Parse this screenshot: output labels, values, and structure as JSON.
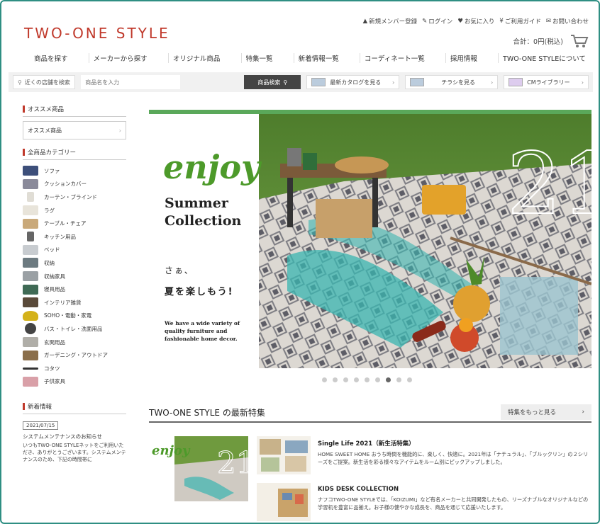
{
  "brand": {
    "logo_text": "TWO-ONE STYLE",
    "accent": "#c0392b",
    "frame_color": "#2f8f83"
  },
  "header": {
    "links": [
      "新規メンバー登録",
      "ログイン",
      "お気に入り",
      "ご利用ガイド",
      "お問い合わせ"
    ],
    "cart_total": "合計：0円(税込)"
  },
  "nav": {
    "items": [
      "商品を探す",
      "メーカーから探す",
      "オリジナル商品",
      "特集一覧",
      "新着情報一覧",
      "コーディネート一覧",
      "採用情報",
      "TWO-ONE STYLEについて"
    ]
  },
  "searchbar": {
    "store_search": "近くの店舗を検索",
    "product_placeholder": "商品名を入力",
    "search_button": "商品検索",
    "promos": [
      "最新カタログを見る",
      "チラシを見る",
      "CMライブラリー"
    ]
  },
  "sidebar": {
    "recommend_heading": "オススメ商品",
    "recommend_select": "オススメ商品",
    "category_heading": "全商品カテゴリー",
    "categories": [
      "ソファ",
      "クッションカバー",
      "カーテン・ブラインド",
      "ラグ",
      "テーブル・チェア",
      "キッチン用品",
      "ベッド",
      "収納",
      "収納家具",
      "寝具用品",
      "インテリア雑貨",
      "SOHO・電動・家電",
      "バス・トイレ・洗面用品",
      "玄関用品",
      "ガーデニング・アウトドア",
      "コタツ",
      "子供家具"
    ],
    "news_heading": "新着情報",
    "news_date": "2021/07/15",
    "news_title": "システムメンテナンスのお知らせ",
    "news_body": "いつもTWO-ONE STYLEネットをご利用いただき、ありがとうございます。システムメンテナンスのため、下記の時間帯に"
  },
  "hero": {
    "enjoy": "enjoy",
    "title_line1": "Summer",
    "title_line2": "Collection",
    "jp_line1": "さぁ、",
    "jp_line2": "夏を楽しもう!",
    "desc": "We have a wide variety of quality furniture and fashionable home decor.",
    "number": "21"
  },
  "carousel": {
    "count": 9,
    "active": 7
  },
  "features": {
    "heading": "TWO-ONE STYLE の最新特集",
    "more_label": "特集をもっと見る",
    "items": [
      {
        "title": "Single Life 2021（新生活特集）",
        "desc": "HOME SWEET HOME おうち時間を機能的に、楽しく、快適に。2021年は「ナチュラル」、「ブルックリン」の２シリーズをご提案。新生活を彩る様々なアイテムをルーム別にピックアップしました。"
      },
      {
        "title": "KIDS DESK COLLECTION",
        "desc": "ナフコTWO-ONE STYLEでは、「KOIZUMI」など有名メーカーと共同開発したもの、リーズナブルなオリジナルなどの学習机を豊富に品揃え。お子様の健やかな成長を、商品を通じて応援いたします。"
      }
    ]
  }
}
